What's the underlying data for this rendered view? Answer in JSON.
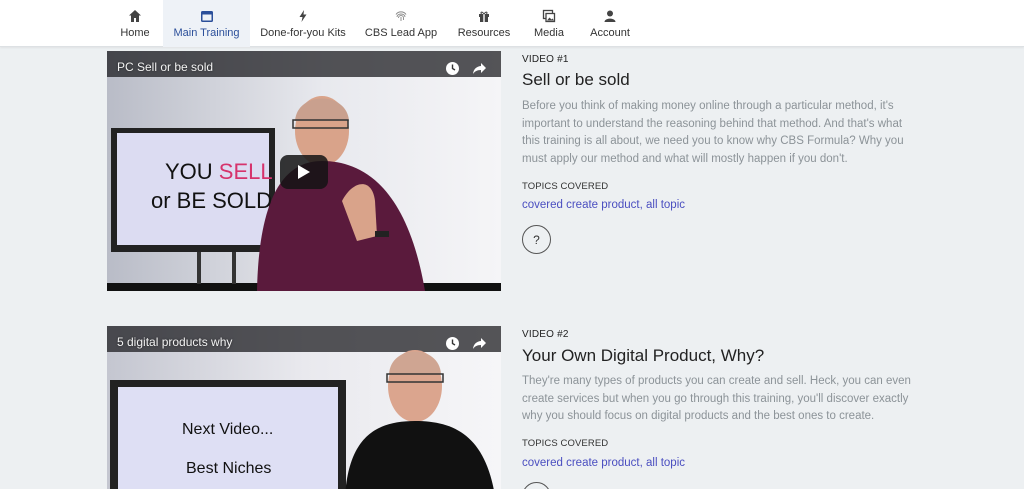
{
  "nav": {
    "items": [
      {
        "label": "Home",
        "icon": "home-icon"
      },
      {
        "label": "Main Training",
        "icon": "calendar-icon",
        "active": true
      },
      {
        "label": "Done-for-you Kits",
        "icon": "bolt-icon"
      },
      {
        "label": "CBS Lead App",
        "icon": "fingerprint-icon"
      },
      {
        "label": "Resources",
        "icon": "gift-icon"
      },
      {
        "label": "Media",
        "icon": "media-icon"
      },
      {
        "label": "Account",
        "icon": "user-icon"
      }
    ]
  },
  "videos": [
    {
      "player_title": "PC Sell or be sold",
      "screen_text_1a": "YOU ",
      "screen_text_1b": "SELL",
      "screen_text_2": "or BE SOLD",
      "number": "VIDEO #1",
      "title": "Sell or be sold",
      "description": "Before you think of making money online through a particular method, it's important to understand the reasoning behind that method. And that's what this training is all about, we need you to know why CBS Formula? Why you must apply our method and what will mostly happen if you don't.",
      "topics_label": "TOPICS COVERED",
      "topics": "covered create product, all topic",
      "help": "?"
    },
    {
      "player_title": "5 digital products why",
      "screen_text_1a": "Next Video...",
      "screen_text_2": "Best Niches",
      "number": "VIDEO #2",
      "title": "Your Own Digital Product, Why?",
      "description": "They're many types of products you can create and sell. Heck, you can even create services but when you go through this training, you'll discover exactly why you should focus on digital products and the best ones to create.",
      "topics_label": "TOPICS COVERED",
      "topics": "covered create product, all topic",
      "help": "?"
    }
  ],
  "colors": {
    "accent": "#2b4f9a",
    "link": "#4a4ec0",
    "sell_pink": "#d6336c",
    "background": "#edf0f2"
  }
}
